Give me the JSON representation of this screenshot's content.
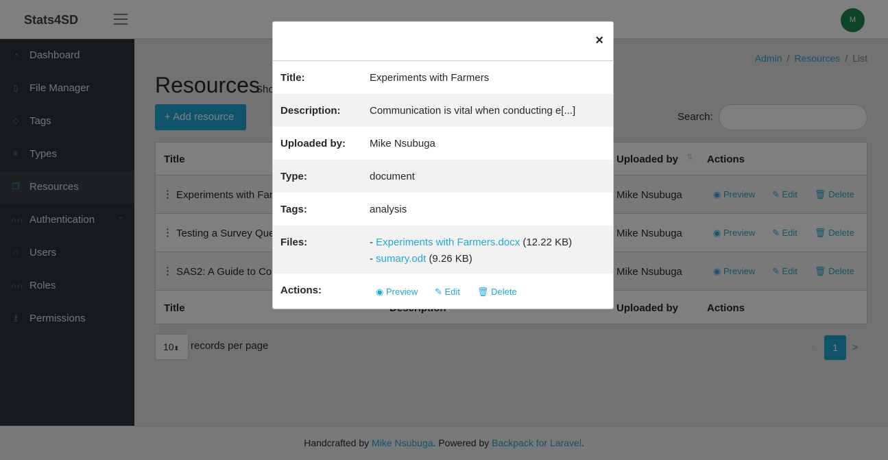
{
  "header": {
    "brand": "Stats4SD",
    "avatar_initial": "M"
  },
  "sidebar": {
    "items": [
      {
        "label": "Dashboard",
        "icon": "gauge-icon"
      },
      {
        "label": "File Manager",
        "icon": "file-icon"
      },
      {
        "label": "Tags",
        "icon": "tag-icon"
      },
      {
        "label": "Types",
        "icon": "list-icon"
      },
      {
        "label": "Resources",
        "icon": "copy-icon"
      },
      {
        "label": "Authentication",
        "icon": "group-icon"
      },
      {
        "label": "Users",
        "icon": "user-icon"
      },
      {
        "label": "Roles",
        "icon": "group-icon"
      },
      {
        "label": "Permissions",
        "icon": "key-icon"
      }
    ]
  },
  "breadcrumb": {
    "admin": "Admin",
    "resources": "Resources",
    "current": "List",
    "separator": "/"
  },
  "page": {
    "title": "Resources",
    "subtitle": "Sho",
    "add_button": "+ Add resource",
    "search_label": "Search:"
  },
  "table": {
    "headers": {
      "title": "Title",
      "description": "Description",
      "uploaded_by": "Uploaded by",
      "actions": "Actions"
    },
    "rows": [
      {
        "title": "Experiments with Far",
        "uploaded_by": "Mike Nsubuga"
      },
      {
        "title": "Testing a Survey Que",
        "uploaded_by": "Mike Nsubuga"
      },
      {
        "title": "SAS2: A Guide to Coll",
        "uploaded_by": "Mike Nsubuga"
      }
    ],
    "actions": {
      "preview": "Preview",
      "edit": "Edit",
      "delete": "Delete"
    }
  },
  "pagination": {
    "per_page": "10",
    "per_page_label": "records per page",
    "prev": "<",
    "current": "1",
    "next": ">"
  },
  "footer": {
    "prefix": "Handcrafted by ",
    "author": "Mike Nsubuga",
    "middle": ". Powered by ",
    "framework": "Backpack for Laravel",
    "suffix": "."
  },
  "modal": {
    "close": "×",
    "labels": {
      "title": "Title:",
      "description": "Description:",
      "uploaded_by": "Uploaded by:",
      "type": "Type:",
      "tags": "Tags:",
      "files": "Files:",
      "actions": "Actions:"
    },
    "values": {
      "title": "Experiments with Farmers",
      "description": "Communication is vital when conducting e[...]",
      "uploaded_by": "Mike Nsubuga",
      "type": "document",
      "tags": "analysis"
    },
    "files": [
      {
        "prefix": "- ",
        "name": "Experiments with Farmers.docx",
        "size": "(12.22 KB)"
      },
      {
        "prefix": "- ",
        "name": "sumary.odt",
        "size": "(9.26 KB)"
      }
    ],
    "actions": {
      "preview": "Preview",
      "edit": "Edit",
      "delete": "Delete"
    }
  },
  "colors": {
    "accent": "#20a8d8",
    "sidebar": "#2f353a",
    "avatar": "#1f8a4c"
  }
}
